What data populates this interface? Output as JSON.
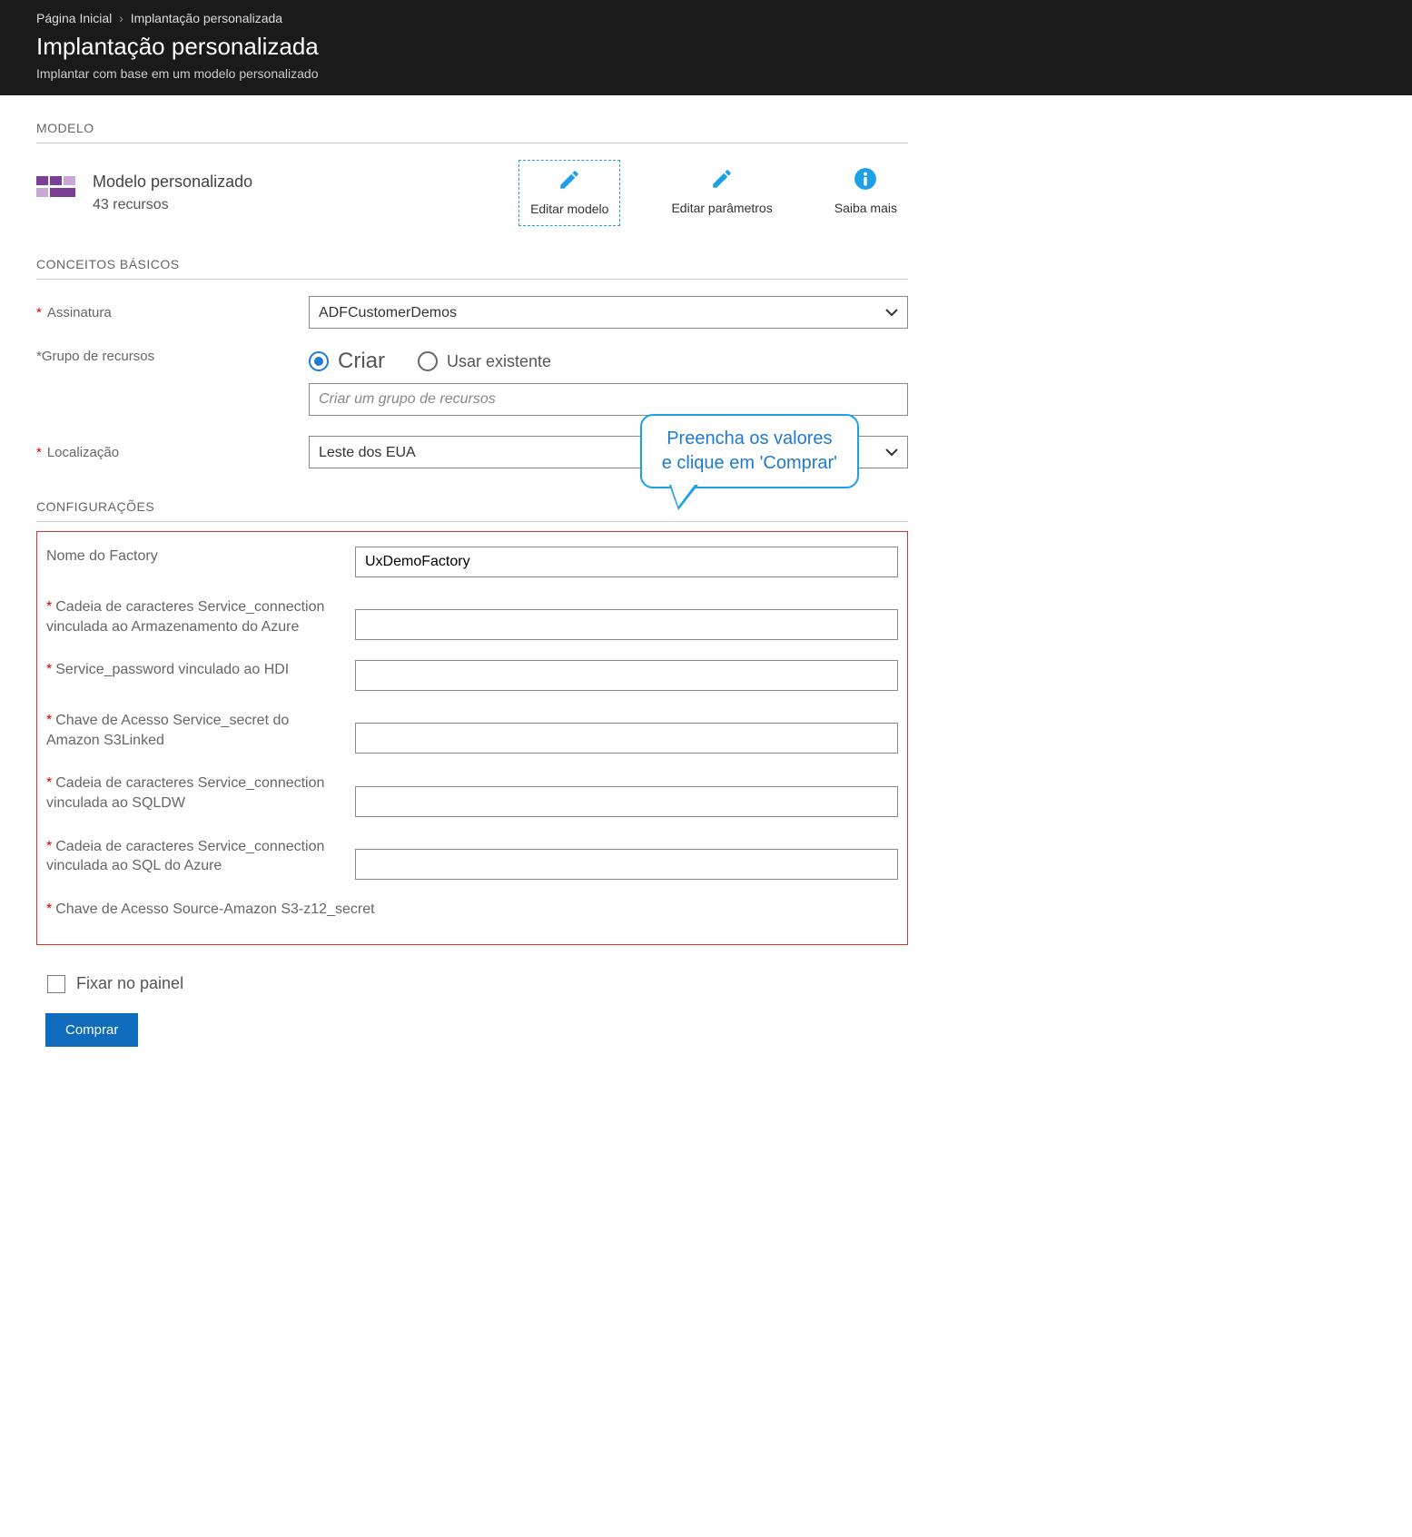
{
  "breadcrumb": {
    "home": "Página Inicial",
    "current": "Implantação personalizada"
  },
  "header": {
    "title": "Implantação personalizada",
    "subtitle": "Implantar com base em um modelo personalizado"
  },
  "section_model_label": "MODELO",
  "model_card": {
    "title": "Modelo personalizado",
    "resources_line": "43 recursos"
  },
  "model_actions": {
    "edit_template": "Editar modelo",
    "edit_params": "Editar parâmetros",
    "learn_more": "Saiba mais"
  },
  "section_basics_label": "CONCEITOS BÁSICOS",
  "basics": {
    "subscription_label": "Assinatura",
    "subscription_value": "ADFCustomerDemos",
    "resource_group_label": "*Grupo de recursos",
    "radio_create": "Criar",
    "radio_use_existing": "Usar existente",
    "rg_placeholder": "Criar um grupo de recursos",
    "location_label": "Localização",
    "location_value": "Leste dos EUA"
  },
  "callout": {
    "line1": "Preencha os valores",
    "line2": "e clique em 'Comprar'"
  },
  "section_settings_label": "CONFIGURAÇÕES",
  "settings": {
    "factory_name_label": "Nome do Factory",
    "factory_name_value": "UxDemoFactory",
    "storage_conn_label": "Cadeia de caracteres Service_connection vinculada ao Armazenamento do Azure",
    "hdi_pwd_label": "Service_password vinculado ao HDI",
    "s3_secret_label": "Chave de Acesso Service_secret do Amazon S3Linked",
    "sqldw_conn_label": "Cadeia de caracteres Service_connection vinculada ao SQLDW",
    "azuresql_conn_label": "Cadeia de caracteres Service_connection vinculada ao SQL do Azure",
    "src_s3_secret_label": "Chave de Acesso Source-Amazon S3-z12_secret"
  },
  "footer": {
    "pin_label": "Fixar no painel",
    "buy_label": "Comprar"
  },
  "colors": {
    "accent": "#1ea0e6",
    "primary_btn": "#0f6cbd",
    "required": "#d40000"
  }
}
